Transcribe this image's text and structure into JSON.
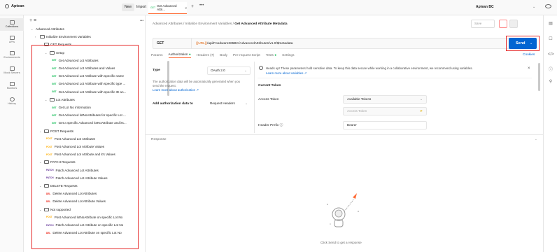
{
  "workspace": {
    "name": "Aptean",
    "new_label": "New",
    "import_label": "Import"
  },
  "tabs": {
    "active_method": "GET",
    "active_title": "Get Advanced Attri...",
    "close": "×",
    "plus": "+",
    "more": "•••"
  },
  "environment": {
    "name": "Aptean BC",
    "chevron": "⌄"
  },
  "rail": {
    "items": [
      {
        "label": "Collections"
      },
      {
        "label": "APIs"
      },
      {
        "label": "Environments"
      },
      {
        "label": "Mock Servers"
      },
      {
        "label": "Monitors"
      },
      {
        "label": "History"
      }
    ]
  },
  "sidebar": {
    "tools": "+  ≡",
    "more": "•••",
    "rows": [
      {
        "text": "Advanced Attributes",
        "kind": "collection"
      },
      {
        "text": "Initialize Environment Variables",
        "kind": "folder"
      },
      {
        "text": "GET Requests",
        "kind": "folder"
      },
      {
        "text": "Setup",
        "kind": "folder"
      },
      {
        "method": "GET",
        "text": "Get Advanced Lot Attributes"
      },
      {
        "method": "GET",
        "text": "Get Advanced Lot Attributes and Values"
      },
      {
        "method": "GET",
        "text": "Get Advanced Lot Attribute with specific name"
      },
      {
        "method": "GET",
        "text": "Get Advanced Lot Attribute with specific type ..."
      },
      {
        "method": "GET",
        "text": "Get Advanced Lot Attribute with specific ID an..."
      },
      {
        "text": "Lot Attributes",
        "kind": "folder"
      },
      {
        "method": "GET",
        "text": "Get Lot No information"
      },
      {
        "method": "GET",
        "text": "Get Advanced lotNoAttributes for specific Lot ..."
      },
      {
        "method": "GET",
        "text": "Get a specific Advanced lotNoAttribute and its..."
      },
      {
        "text": "POST Requests",
        "kind": "folder"
      },
      {
        "method": "POST",
        "text": "Post Advanced Lot Attributes"
      },
      {
        "method": "POST",
        "text": "Post Advanced Lot Attribute Values"
      },
      {
        "method": "POST",
        "text": "Post Advanced Lot Attribute and it's Values"
      },
      {
        "text": "PATCH Requests",
        "kind": "folder"
      },
      {
        "method": "PATCH",
        "text": "Patch Advanced Lot Attributes"
      },
      {
        "method": "PATCH",
        "text": "Patch Advanced Lot Attribute Values"
      },
      {
        "text": "DELETE Requests",
        "kind": "folder"
      },
      {
        "method": "DEL",
        "text": "Delete Advanced Lot Attributes"
      },
      {
        "method": "DEL",
        "text": "Delete Advanced Lot Attribute Values"
      },
      {
        "text": "Not supported",
        "kind": "folder"
      },
      {
        "method": "POST",
        "text": "Post Advanced lotNoAttribute on specific Lot No"
      },
      {
        "method": "PATCH",
        "text": "Patch Advanced Lot Attribute on specific Lot No"
      },
      {
        "method": "DEL",
        "text": "Delete Advanced Lot Attribute on specific Lot No"
      }
    ]
  },
  "breadcrumb": {
    "path": "Advanced Attributes / Initialize Environment Variables / ",
    "current": "Get Advanced Attribute Metadata"
  },
  "toolbar": {
    "save_label": "Save"
  },
  "request": {
    "method": "GET",
    "url_var": "{{URL}}",
    "url_rest": "/api/Foodware365BC/AdvancedAttributes/v1.0/$metadata",
    "send_label": "Send"
  },
  "subtabs": {
    "params": "Params",
    "authorization": "Authorization",
    "headers": "Headers (7)",
    "body": "Body",
    "prerequest": "Pre-request Script",
    "tests": "Tests",
    "settings": "Settings",
    "cookies": "Cookies"
  },
  "auth": {
    "type_label": "Type",
    "type_value": "OAuth 2.0",
    "desc": "The authorization data will be automatically generated when you send the request.",
    "desc_link": "Learn more about authorization ↗",
    "add_label": "Add authorization data to",
    "add_value": "Request Headers",
    "notice": "Heads up! These parameters hold sensitive data. To keep this data secure while working in a collaborative environment, we recommend using variables.",
    "notice_link": "Learn more about variables ↗",
    "current_token": "Current Token",
    "access_token_label": "Access Token",
    "access_token_select": "Available Tokens",
    "access_token_placeholder": "Access Token",
    "header_prefix_label": "Header Prefix ⓘ",
    "header_prefix_value": "Bearer"
  },
  "response": {
    "label": "Response",
    "empty": "Click Send to get a response"
  },
  "colors": {
    "get": "#0cbb52",
    "post": "#ffad00",
    "patch": "#623497",
    "delete": "#eb2013",
    "send": "#0265d2",
    "highlight": "#e62b2b",
    "accent": "#ff6c37"
  }
}
